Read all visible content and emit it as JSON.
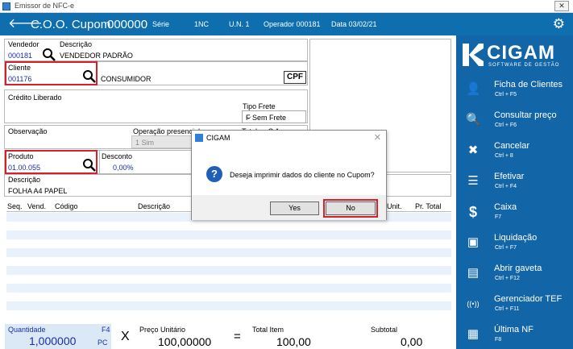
{
  "window": {
    "title": "Emissor de NFC-e",
    "close_glyph": "✕"
  },
  "header": {
    "back_glyph": "🡐",
    "title": "C.O.O. Cupom",
    "coupon_number": "000000",
    "serie_label": "Série",
    "serie_value": "1NC",
    "un_label": "U.N. 1",
    "operator": "Operador 000181",
    "date": "Data  03/02/21",
    "settings_glyph": "⚙"
  },
  "form": {
    "vendedor_label": "Vendedor",
    "vendedor_code": "000181",
    "descricao_label": "Descrição",
    "vendedor_desc": "VENDEDOR PADRÃO",
    "cliente_label": "Cliente",
    "cliente_code": "001176",
    "cliente_name": "CONSUMIDOR",
    "cpf_button": "CPF",
    "credito_label": "Crédito Liberado",
    "tipo_frete_label": "Tipo Frete",
    "tipo_frete_value": "F Sem Frete",
    "observacao_label": "Observação",
    "operacao_label": "Operação presencial",
    "operacao_value": "1 Sim",
    "total_partial": "Total  -  -  C A",
    "produto_label": "Produto",
    "produto_code": "01.00.055",
    "desconto_label": "Desconto",
    "desconto_value": "0,00%",
    "descricao2_label": "Descrição",
    "produto_desc": "FOLHA A4 PAPEL"
  },
  "grid": {
    "columns": [
      "Seq.",
      "Vend.",
      "Código",
      "Descrição",
      "Unit.",
      "Pr. Total"
    ]
  },
  "footer": {
    "quantidade_label": "Quantidade",
    "quantidade_key": "F4",
    "quantidade_value": "1,000000",
    "quantidade_unit": "PC",
    "times": "X",
    "preco_label": "Preço Unitário",
    "preco_value": "100,00000",
    "equals": "=",
    "total_label": "Total Item",
    "total_value": "100,00",
    "subtotal_label": "Subtotal",
    "subtotal_value": "0,00"
  },
  "sidebar": {
    "logo_text": "CIGAM",
    "logo_sub": "SOFTWARE DE GESTÃO",
    "items": [
      {
        "label": "Ficha de Clientes",
        "shortcut": "Ctrl + F5",
        "icon": "👤"
      },
      {
        "label": "Consultar preço",
        "shortcut": "Ctrl + F6",
        "icon": "🔍"
      },
      {
        "label": "Cancelar",
        "shortcut": "Ctrl + 8",
        "icon": "✖"
      },
      {
        "label": "Efetivar",
        "shortcut": "Ctrl + F4",
        "icon": "☰"
      },
      {
        "label": "Caixa",
        "shortcut": "F7",
        "icon": "$"
      },
      {
        "label": "Liquidação",
        "shortcut": "Ctrl + F7",
        "icon": "▣"
      },
      {
        "label": "Abrir gaveta",
        "shortcut": "Ctrl + F12",
        "icon": "▤"
      },
      {
        "label": "Gerenciador TEF",
        "shortcut": "Ctrl + F11",
        "icon": "((•))"
      },
      {
        "label": "Última NF",
        "shortcut": "F8",
        "icon": "▦"
      }
    ]
  },
  "dialog": {
    "title": "CIGAM",
    "close_glyph": "✕",
    "question_glyph": "?",
    "message": "Deseja imprimir dados do cliente no Cupom?",
    "yes_label": "Yes",
    "no_label": "No"
  },
  "colors": {
    "brand": "#1266a8",
    "highlight": "#d3202a",
    "value_text": "#1b2fa8"
  }
}
